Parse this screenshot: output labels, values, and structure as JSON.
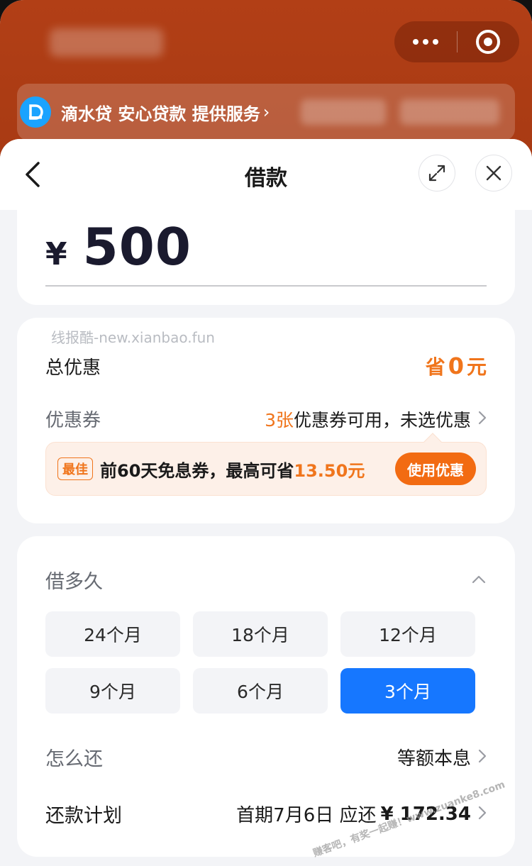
{
  "provider": {
    "name": "滴水贷 安心贷款 提供服务",
    "chevron": "›",
    "logo_icon": "didi-logo-icon"
  },
  "nav": {
    "title": "借款",
    "back_icon": "back-arrow-icon",
    "expand_icon": "expand-icon",
    "close_icon": "close-icon"
  },
  "amount": {
    "currency": "¥",
    "value": "500"
  },
  "discount": {
    "watermark": "线报酷-new.xianbao.fun",
    "total_label": "总优惠",
    "save_prefix": "省",
    "save_value": "0",
    "save_unit": "元",
    "coupon_label": "优惠券",
    "coupon_count": "3张",
    "coupon_text": "优惠券可用，未选优惠",
    "best_tag": "最佳",
    "best_text": "前60天免息券，最高可省",
    "best_amount": "13.50元",
    "use_button": "使用优惠"
  },
  "term": {
    "title": "借多久",
    "options": [
      "24个月",
      "18个月",
      "12个月",
      "9个月",
      "6个月",
      "3个月"
    ],
    "selected": "3个月",
    "repay_label": "怎么还",
    "repay_value": "等额本息",
    "plan_label": "还款计划",
    "plan_prefix": "首期7月6日 应还",
    "plan_amount": "¥ 172.34",
    "corner_watermark": "赚客吧，有奖一起赚！www.zuanke8.com"
  },
  "colors": {
    "accent_blue": "#1677ff",
    "accent_orange": "#f0751c",
    "header_orange": "#b23f16"
  }
}
